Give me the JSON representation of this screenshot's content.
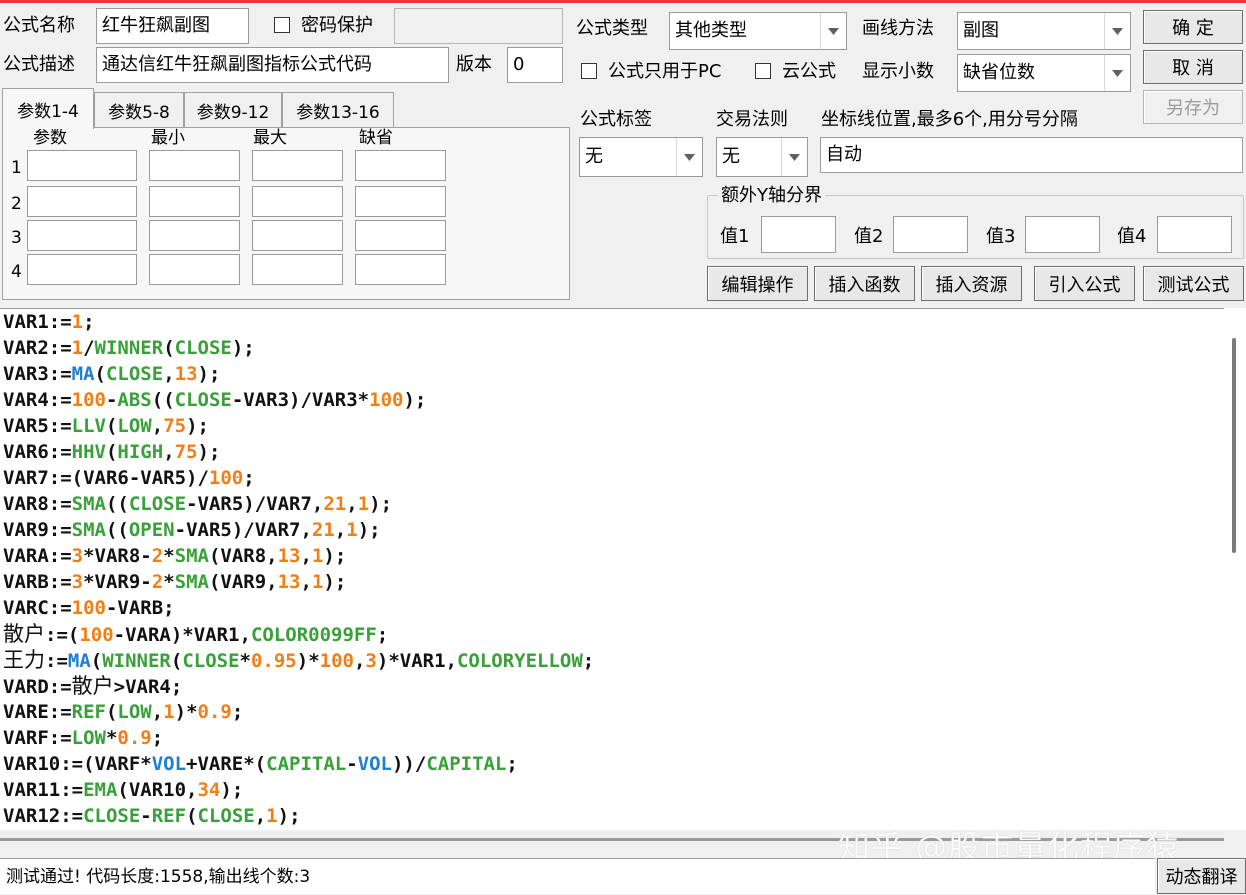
{
  "top_form": {
    "name_label": "公式名称",
    "name_value": "红牛狂飙副图",
    "password_label": "密码保护",
    "desc_label": "公式描述",
    "desc_value": "通达信红牛狂飙副图指标公式代码",
    "version_label": "版本",
    "version_value": "0",
    "type_label": "公式类型",
    "type_value": "其他类型",
    "draw_label": "画线方法",
    "draw_value": "副图",
    "pc_only_label": "公式只用于PC",
    "cloud_label": "云公式",
    "decimals_label": "显示小数",
    "decimals_value": "缺省位数",
    "formula_tag_label": "公式标签",
    "formula_tag_value": "无",
    "trade_rule_label": "交易法则",
    "trade_rule_value": "无",
    "coord_label": "坐标线位置,最多6个,用分号分隔",
    "coord_value": "自动",
    "extra_y_label": "额外Y轴分界",
    "y_values": [
      "值1",
      "值2",
      "值3",
      "值4"
    ]
  },
  "buttons": {
    "ok": "确 定",
    "cancel": "取 消",
    "save_as": "另存为",
    "edit_ops": "编辑操作",
    "insert_func": "插入函数",
    "insert_res": "插入资源",
    "import_formula": "引入公式",
    "test_formula": "测试公式",
    "dynamic_translate": "动态翻译"
  },
  "param_tabs": [
    "参数1-4",
    "参数5-8",
    "参数9-12",
    "参数13-16"
  ],
  "param_headers": [
    "参数",
    "最小",
    "最大",
    "缺省"
  ],
  "param_rows": [
    "1",
    "2",
    "3",
    "4"
  ],
  "code_lines": [
    [
      [
        "VAR1:=",
        ""
      ],
      [
        "1",
        "num"
      ],
      [
        ";",
        ""
      ]
    ],
    [
      [
        "VAR2:=",
        ""
      ],
      [
        "1",
        "num"
      ],
      [
        "/",
        ""
      ],
      [
        "WINNER",
        "fn"
      ],
      [
        "(",
        ""
      ],
      [
        "CLOSE",
        "fn"
      ],
      [
        ");",
        ""
      ]
    ],
    [
      [
        "VAR3:=",
        ""
      ],
      [
        "MA",
        "fnb"
      ],
      [
        "(",
        ""
      ],
      [
        "CLOSE",
        "fn"
      ],
      [
        ",",
        ""
      ],
      [
        "13",
        "num"
      ],
      [
        ");",
        ""
      ]
    ],
    [
      [
        "VAR4:=",
        ""
      ],
      [
        "100",
        "num"
      ],
      [
        "-",
        ""
      ],
      [
        "ABS",
        "fn"
      ],
      [
        "((",
        ""
      ],
      [
        "CLOSE",
        "fn"
      ],
      [
        "-VAR3)/VAR3*",
        ""
      ],
      [
        "100",
        "num"
      ],
      [
        ");",
        ""
      ]
    ],
    [
      [
        "VAR5:=",
        ""
      ],
      [
        "LLV",
        "fn"
      ],
      [
        "(",
        ""
      ],
      [
        "LOW",
        "fn"
      ],
      [
        ",",
        ""
      ],
      [
        "75",
        "num"
      ],
      [
        ");",
        ""
      ]
    ],
    [
      [
        "VAR6:=",
        ""
      ],
      [
        "HHV",
        "fn"
      ],
      [
        "(",
        ""
      ],
      [
        "HIGH",
        "fn"
      ],
      [
        ",",
        ""
      ],
      [
        "75",
        "num"
      ],
      [
        ");",
        ""
      ]
    ],
    [
      [
        "VAR7:=(VAR6-VAR5)/",
        ""
      ],
      [
        "100",
        "num"
      ],
      [
        ";",
        ""
      ]
    ],
    [
      [
        "VAR8:=",
        ""
      ],
      [
        "SMA",
        "fn"
      ],
      [
        "((",
        ""
      ],
      [
        "CLOSE",
        "fn"
      ],
      [
        "-VAR5)/VAR7,",
        ""
      ],
      [
        "21",
        "num"
      ],
      [
        ",",
        ""
      ],
      [
        "1",
        "num"
      ],
      [
        ");",
        ""
      ]
    ],
    [
      [
        "VAR9:=",
        ""
      ],
      [
        "SMA",
        "fn"
      ],
      [
        "((",
        ""
      ],
      [
        "OPEN",
        "fn"
      ],
      [
        "-VAR5)/VAR7,",
        ""
      ],
      [
        "21",
        "num"
      ],
      [
        ",",
        ""
      ],
      [
        "1",
        "num"
      ],
      [
        ");",
        ""
      ]
    ],
    [
      [
        "VARA:=",
        ""
      ],
      [
        "3",
        "num"
      ],
      [
        "*VAR8-",
        ""
      ],
      [
        "2",
        "num"
      ],
      [
        "*",
        ""
      ],
      [
        "SMA",
        "fn"
      ],
      [
        "(VAR8,",
        ""
      ],
      [
        "13",
        "num"
      ],
      [
        ",",
        ""
      ],
      [
        "1",
        "num"
      ],
      [
        ");",
        ""
      ]
    ],
    [
      [
        "VARB:=",
        ""
      ],
      [
        "3",
        "num"
      ],
      [
        "*VAR9-",
        ""
      ],
      [
        "2",
        "num"
      ],
      [
        "*",
        ""
      ],
      [
        "SMA",
        "fn"
      ],
      [
        "(VAR9,",
        ""
      ],
      [
        "13",
        "num"
      ],
      [
        ",",
        ""
      ],
      [
        "1",
        "num"
      ],
      [
        ");",
        ""
      ]
    ],
    [
      [
        "VARC:=",
        ""
      ],
      [
        "100",
        "num"
      ],
      [
        "-VARB;",
        ""
      ]
    ],
    [
      [
        "散户",
        "cn"
      ],
      [
        ":=(",
        ""
      ],
      [
        "100",
        "num"
      ],
      [
        "-VARA)*VAR1,",
        ""
      ],
      [
        "COLOR0099FF",
        "fn"
      ],
      [
        ";",
        ""
      ]
    ],
    [
      [
        "王力",
        "cn"
      ],
      [
        ":=",
        ""
      ],
      [
        "MA",
        "fnb"
      ],
      [
        "(",
        ""
      ],
      [
        "WINNER",
        "fn"
      ],
      [
        "(",
        ""
      ],
      [
        "CLOSE",
        "fn"
      ],
      [
        "*",
        ""
      ],
      [
        "0.95",
        "num"
      ],
      [
        ")*",
        ""
      ],
      [
        "100",
        "num"
      ],
      [
        ",",
        ""
      ],
      [
        "3",
        "num"
      ],
      [
        ")*VAR1,",
        ""
      ],
      [
        "COLORYELLOW",
        "fn"
      ],
      [
        ";",
        ""
      ]
    ],
    [
      [
        "VARD:=",
        ""
      ],
      [
        "散户",
        "cn"
      ],
      [
        ">VAR4;",
        ""
      ]
    ],
    [
      [
        "VARE:=",
        ""
      ],
      [
        "REF",
        "fn"
      ],
      [
        "(",
        ""
      ],
      [
        "LOW",
        "fn"
      ],
      [
        ",",
        ""
      ],
      [
        "1",
        "num"
      ],
      [
        ")*",
        ""
      ],
      [
        "0.9",
        "num"
      ],
      [
        ";",
        ""
      ]
    ],
    [
      [
        "VARF:=",
        ""
      ],
      [
        "LOW",
        "fn"
      ],
      [
        "*",
        ""
      ],
      [
        "0.9",
        "num"
      ],
      [
        ";",
        ""
      ]
    ],
    [
      [
        "VAR10:=(VARF*",
        ""
      ],
      [
        "VOL",
        "fnb"
      ],
      [
        "+VARE*(",
        ""
      ],
      [
        "CAPITAL",
        "fn"
      ],
      [
        "-",
        ""
      ],
      [
        "VOL",
        "fnb"
      ],
      [
        "))/",
        ""
      ],
      [
        "CAPITAL",
        "fn"
      ],
      [
        ";",
        ""
      ]
    ],
    [
      [
        "VAR11:=",
        ""
      ],
      [
        "EMA",
        "fn"
      ],
      [
        "(VAR10,",
        ""
      ],
      [
        "34",
        "num"
      ],
      [
        ");",
        ""
      ]
    ],
    [
      [
        "VAR12:=",
        ""
      ],
      [
        "CLOSE",
        "fn"
      ],
      [
        "-",
        ""
      ],
      [
        "REF",
        "fn"
      ],
      [
        "(",
        ""
      ],
      [
        "CLOSE",
        "fn"
      ],
      [
        ",",
        ""
      ],
      [
        "1",
        "num"
      ],
      [
        ");",
        ""
      ]
    ]
  ],
  "status_text": "测试通过! 代码长度:1558,输出线个数:3",
  "watermark": "知乎 @股市量化程序猿"
}
